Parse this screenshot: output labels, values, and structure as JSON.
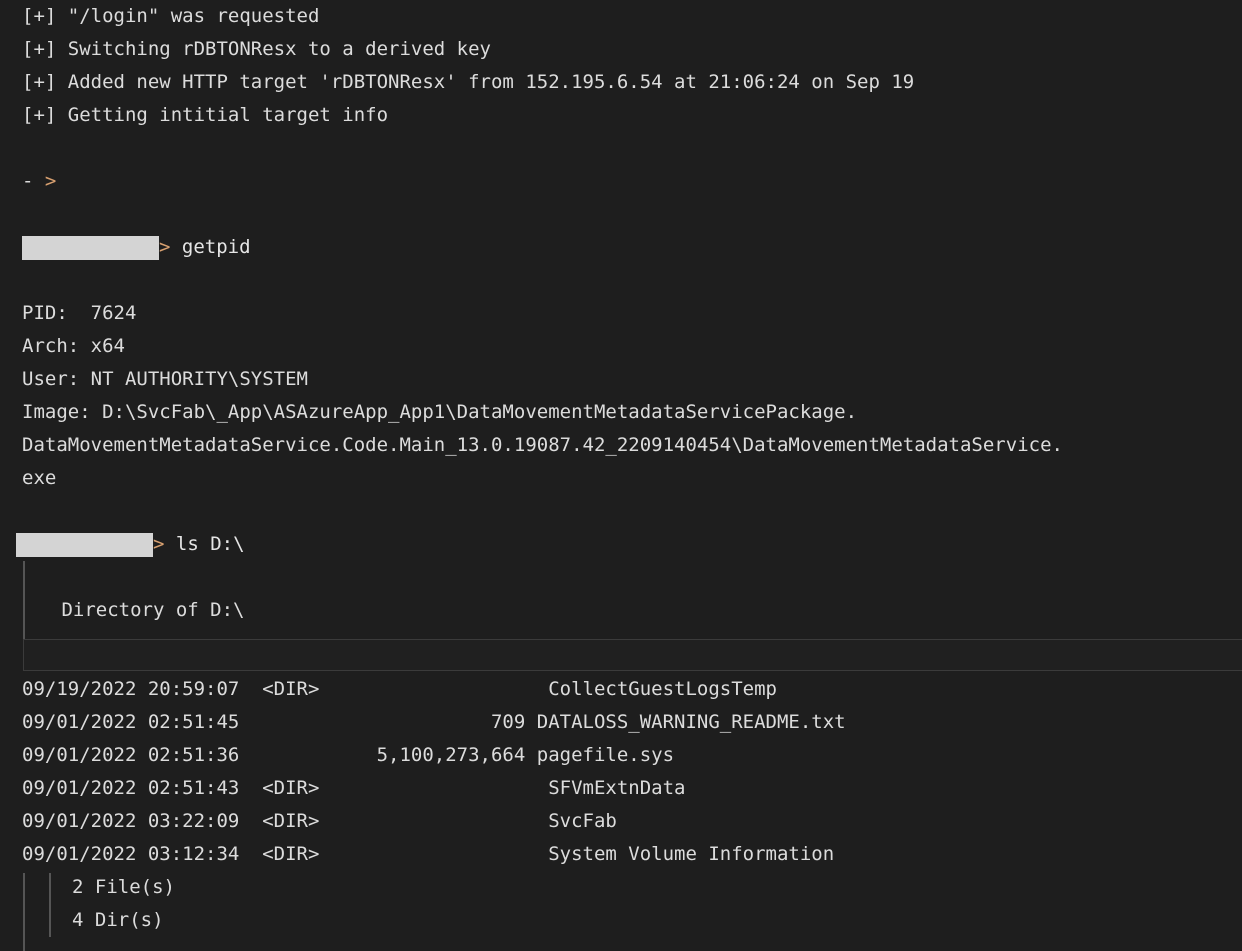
{
  "terminal": {
    "background_color": "#1e1e1e",
    "text_color": "#dcdcdc",
    "prompt_color": "#d8a070",
    "redaction_color": "#d4d4d4",
    "status_lines": [
      "[+] \"/login\" was requested",
      "[+] Switching rDBTONResx to a derived key",
      "[+] Added new HTTP target 'rDBTONResx' from 152.195.6.54 at 21:06:24 on Sep 19",
      "[+] Getting intitial target info"
    ],
    "idle_prompt": "-  >",
    "idle_prompt_dash": "- ",
    "idle_prompt_chevron": ">",
    "prompt_chevron": ">",
    "command_1": " getpid",
    "command_2": " ls D:\\",
    "getpid_output": [
      "PID:  7624",
      "Arch: x64",
      "User: NT AUTHORITY\\SYSTEM",
      "Image: D:\\SvcFab\\_App\\ASAzureApp_App1\\DataMovementMetadataServicePackage.",
      "DataMovementMetadataService.Code.Main_13.0.19087.42_2209140454\\DataMovementMetadataService.",
      "exe"
    ],
    "directory_header": " Directory of D:\\",
    "listing_rows": [
      "09/19/2022 20:59:07  <DIR>                    CollectGuestLogsTemp",
      "09/01/2022 02:51:45                      709 DATALOSS_WARNING_README.txt",
      "09/01/2022 02:51:36            5,100,273,664 pagefile.sys",
      "09/01/2022 02:51:43  <DIR>                    SFVmExtnData",
      "09/01/2022 03:22:09  <DIR>                    SvcFab",
      "09/01/2022 03:12:34  <DIR>                    System Volume Information"
    ],
    "summary_rows": [
      "2 File(s)",
      "4 Dir(s)"
    ]
  }
}
